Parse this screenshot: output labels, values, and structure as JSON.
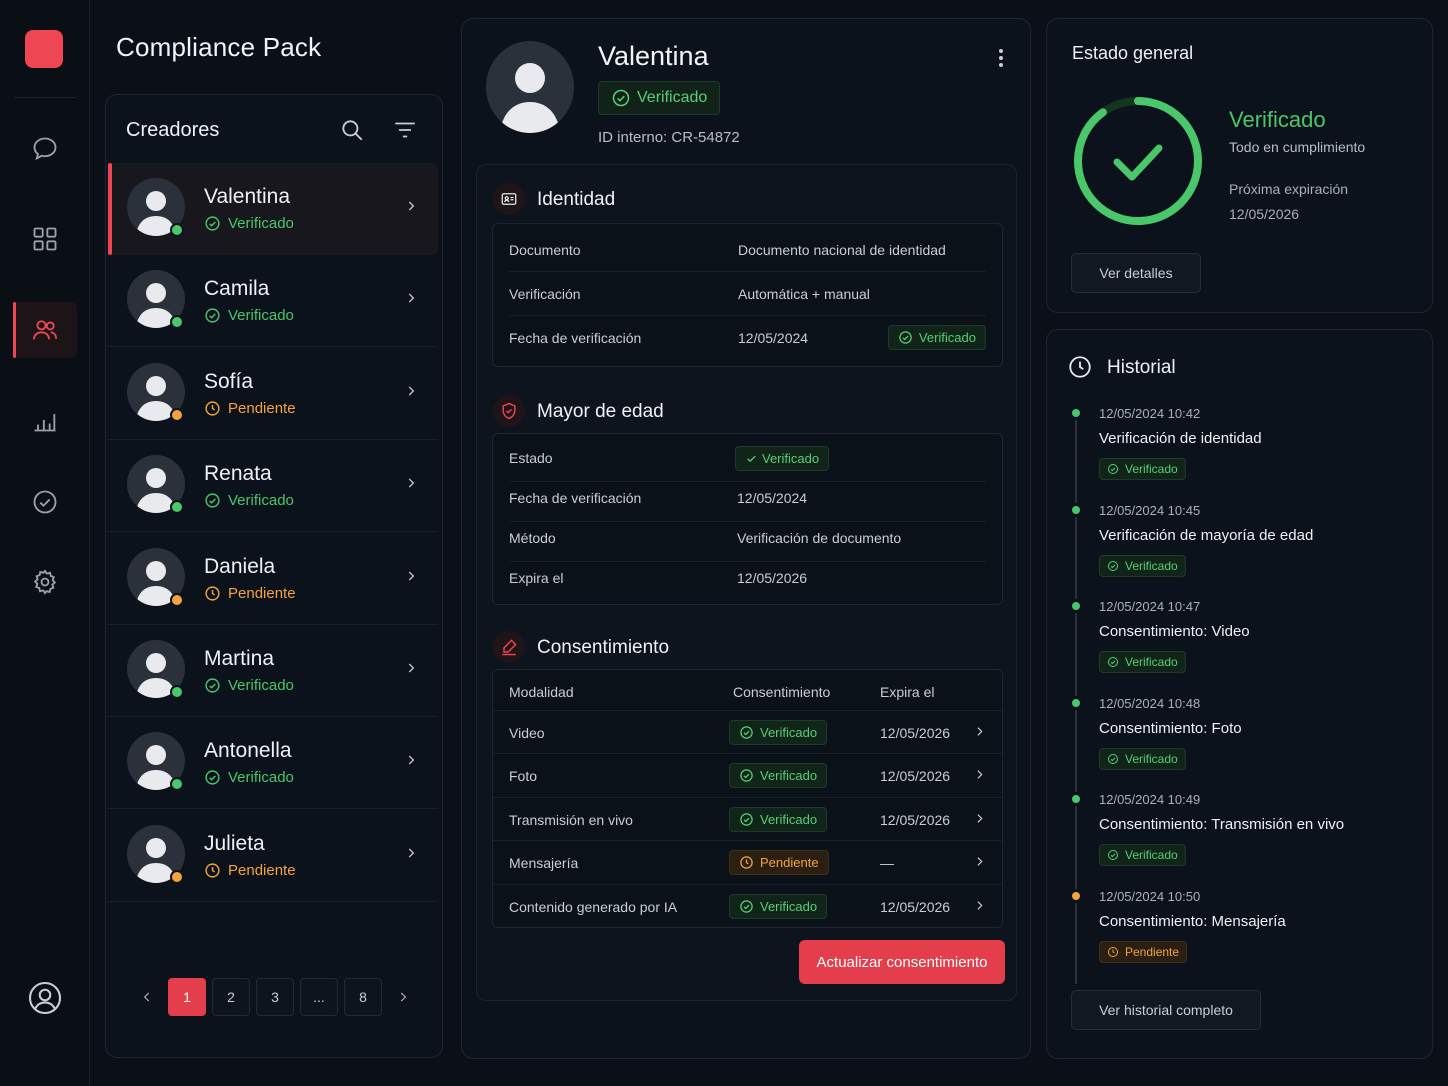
{
  "app": {
    "title": "Compliance Pack"
  },
  "rail": {
    "icons": [
      "chat-icon",
      "grid-icon",
      "users-icon",
      "bar-chart-icon",
      "check-circle-icon",
      "gear-icon",
      "user-circle-icon"
    ]
  },
  "colors": {
    "accent": "#e43d4b",
    "verified": "#49c76a",
    "pending": "#f3a43c"
  },
  "list": {
    "title": "Creadores",
    "items": [
      {
        "name": "Valentina",
        "status": "Verificado",
        "state": "ok"
      },
      {
        "name": "Camila",
        "status": "Verificado",
        "state": "ok"
      },
      {
        "name": "Sofía",
        "status": "Pendiente",
        "state": "pending"
      },
      {
        "name": "Renata",
        "status": "Verificado",
        "state": "ok"
      },
      {
        "name": "Daniela",
        "status": "Pendiente",
        "state": "pending"
      },
      {
        "name": "Martina",
        "status": "Verificado",
        "state": "ok"
      },
      {
        "name": "Antonella",
        "status": "Verificado",
        "state": "ok"
      },
      {
        "name": "Julieta",
        "status": "Pendiente",
        "state": "pending"
      }
    ],
    "pages": [
      "1",
      "2",
      "3",
      "...",
      "8"
    ]
  },
  "profile": {
    "name": "Valentina",
    "status": "Verificado",
    "id": "ID interno: CR-54872"
  },
  "identity": {
    "title": "Identidad",
    "rows": [
      {
        "k": "Documento",
        "v": "Documento nacional de identidad"
      },
      {
        "k": "Verificación",
        "v": "Automática + manual"
      },
      {
        "k": "Fecha de verificación",
        "v": "12/05/2024",
        "chip": "Verificado"
      }
    ]
  },
  "age": {
    "title": "Mayor de edad",
    "rows": [
      {
        "k": "Estado",
        "v": "Verificado"
      },
      {
        "k": "Fecha de verificación",
        "v": "12/05/2024"
      },
      {
        "k": "Método",
        "v": "Verificación de documento"
      },
      {
        "k": "Expira el",
        "v": "12/05/2026"
      }
    ]
  },
  "consent": {
    "title": "Consentimiento",
    "headers": [
      "Modalidad",
      "Consentimiento",
      "Expira el"
    ],
    "rows": [
      {
        "m": "Video",
        "s": "Verificado",
        "e": "12/05/2026",
        "state": "ok"
      },
      {
        "m": "Foto",
        "s": "Verificado",
        "e": "12/05/2026",
        "state": "ok"
      },
      {
        "m": "Transmisión en vivo",
        "s": "Verificado",
        "e": "12/05/2026",
        "state": "ok"
      },
      {
        "m": "Mensajería",
        "s": "Pendiente",
        "e": "—",
        "state": "pending"
      },
      {
        "m": "Contenido generado por IA",
        "s": "Verificado",
        "e": "12/05/2026",
        "state": "ok"
      }
    ],
    "cta": "Actualizar consentimiento"
  },
  "state": {
    "title": "Estado general",
    "status": "Verificado",
    "sub": "Todo en cumplimiento",
    "exp_label": "Próxima expiración",
    "exp_date": "12/05/2026",
    "button": "Ver detalles",
    "progress_pct": 90
  },
  "history": {
    "title": "Historial",
    "events": [
      {
        "t": "12/05/2024 10:42",
        "n": "Verificación de identidad",
        "s": "Verificado",
        "state": "ok"
      },
      {
        "t": "12/05/2024 10:45",
        "n": "Verificación de mayoría de edad",
        "s": "Verificado",
        "state": "ok"
      },
      {
        "t": "12/05/2024 10:47",
        "n": "Consentimiento: Video",
        "s": "Verificado",
        "state": "ok"
      },
      {
        "t": "12/05/2024 10:48",
        "n": "Consentimiento: Foto",
        "s": "Verificado",
        "state": "ok"
      },
      {
        "t": "12/05/2024 10:49",
        "n": "Consentimiento: Transmisión en vivo",
        "s": "Verificado",
        "state": "ok"
      },
      {
        "t": "12/05/2024 10:50",
        "n": "Consentimiento: Mensajería",
        "s": "Pendiente",
        "state": "pending"
      }
    ],
    "button": "Ver historial completo"
  }
}
